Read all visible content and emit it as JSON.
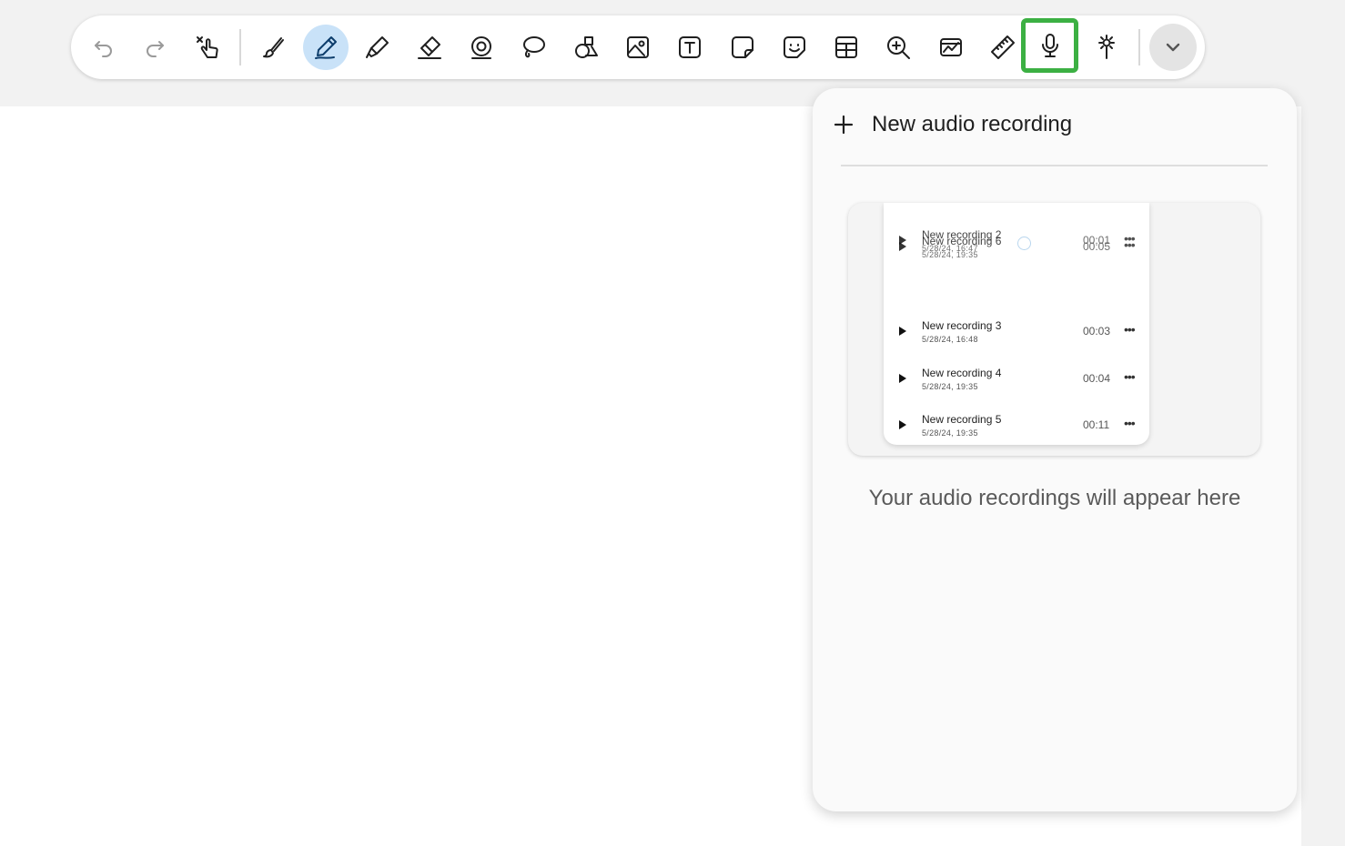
{
  "toolbar": {
    "tools": [
      {
        "name": "undo-icon"
      },
      {
        "name": "redo-icon"
      },
      {
        "name": "touch-off-icon"
      },
      {
        "name": "brush-icon"
      },
      {
        "name": "pen-icon",
        "active": true
      },
      {
        "name": "marker-icon"
      },
      {
        "name": "eraser-icon"
      },
      {
        "name": "stamp-icon"
      },
      {
        "name": "lasso-icon"
      },
      {
        "name": "shapes-icon"
      },
      {
        "name": "image-icon"
      },
      {
        "name": "text-icon"
      },
      {
        "name": "sticky-note-icon"
      },
      {
        "name": "sticker-icon"
      },
      {
        "name": "table-icon"
      },
      {
        "name": "zoom-in-icon"
      },
      {
        "name": "chart-icon"
      },
      {
        "name": "ruler-icon"
      },
      {
        "name": "microphone-icon",
        "focused": true
      },
      {
        "name": "laser-pointer-icon"
      }
    ],
    "more_icon": "chevron-down-icon",
    "accent_color": "#c9e2f8",
    "focus_color": "#3cb043"
  },
  "audio_panel": {
    "new_recording_label": "New audio recording",
    "empty_message": "Your audio recordings will appear here",
    "illustration": {
      "overlapping": [
        {
          "name": "New recording 2",
          "date": "5/28/24, 16:47",
          "duration": "00:01"
        },
        {
          "name": "New recording 6",
          "date": "5/28/24, 19:35",
          "duration": "00:05"
        }
      ],
      "rows": [
        {
          "name": "New recording 3",
          "date": "5/28/24, 16:48",
          "duration": "00:03"
        },
        {
          "name": "New recording 4",
          "date": "5/28/24, 19:35",
          "duration": "00:04"
        },
        {
          "name": "New recording 5",
          "date": "5/28/24, 19:35",
          "duration": "00:11"
        }
      ]
    }
  }
}
